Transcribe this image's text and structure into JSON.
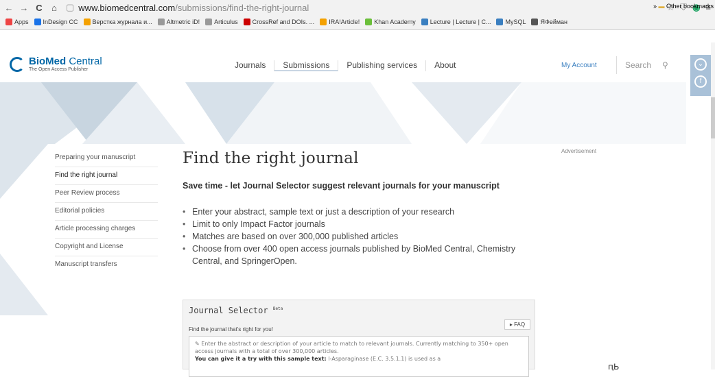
{
  "browser": {
    "url_domain": "www.biomedcentral.com",
    "url_path": "/submissions/find-the-right-journal",
    "bookmarks": [
      "Apps",
      "InDesign CC",
      "Верстка журнала и...",
      "Altmetric iD!",
      "Articulus",
      "CrossRef and DOIs. ...",
      "IRA!Article!",
      "Khan Academy",
      "Lecture | Lecture | C...",
      "MySQL",
      "ЯФейман"
    ],
    "other_bookmarks": "Other bookmarks"
  },
  "header": {
    "logo_bold": "BioMed",
    "logo_rest": " Central",
    "logo_tagline": "The Open Access Publisher",
    "nav": [
      "Journals",
      "Submissions",
      "Publishing services",
      "About"
    ],
    "my_account": "My Account",
    "search_placeholder": "Search"
  },
  "sidebar": {
    "items": [
      "Preparing your manuscript",
      "Find the right journal",
      "Peer Review process",
      "Editorial policies",
      "Article processing charges",
      "Copyright and License",
      "Manuscript transfers"
    ]
  },
  "main": {
    "title": "Find the right journal",
    "lead": "Save time - let Journal Selector suggest relevant journals for your manuscript",
    "bullets": [
      "Enter your abstract, sample text or just a description of your research",
      "Limit to only Impact Factor journals",
      "Matches are based on over 300,000 published articles",
      "Choose from over 400 open access journals published by BioMed Central, Chemistry Central, and SpringerOpen."
    ],
    "advertisement": "Advertisement"
  },
  "journal_selector": {
    "title": "Journal Selector",
    "beta": "Beta",
    "subtitle": "Find the journal that's right for you!",
    "faq": "▸ FAQ",
    "placeholder_1": "✎ Enter the abstract or description of your article to match to relevant journals. Currently matching to 350+ open access journals with a total of over 300,000 articles.",
    "sample_label": "You can give it a try with this sample text:",
    "sample_text": " l-Asparaginase (E.C. 3.5.1.1) is used as a"
  },
  "bottom_mark": "ԥЬ"
}
